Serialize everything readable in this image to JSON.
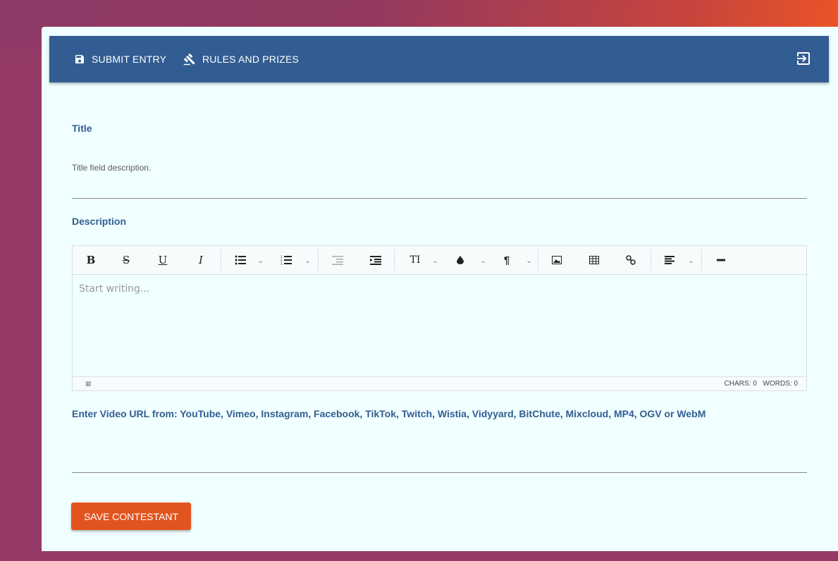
{
  "header": {
    "submit_label": "SUBMIT ENTRY",
    "rules_label": "RULES AND PRIZES"
  },
  "form": {
    "title_label": "Title",
    "title_help": "Title field description.",
    "description_label": "Description",
    "editor_placeholder": "Start writing...",
    "chars": "CHARS: 0",
    "words": "WORDS: 0",
    "video_label": "Enter Video URL from: YouTube, Vimeo, Instagram, Facebook, TikTok, Twitch, Wistia, Vidyyard, BitChute, Mixcloud, MP4, OGV or WebM",
    "save_label": "SAVE CONTESTANT"
  },
  "toolbar": {
    "bold": "B",
    "strike": "S",
    "underline": "U",
    "italic": "I",
    "font_size": "TI",
    "paragraph": "¶"
  },
  "colors": {
    "appbar": "#325d92",
    "accent": "#e2541f",
    "card": "#f0ffff"
  }
}
